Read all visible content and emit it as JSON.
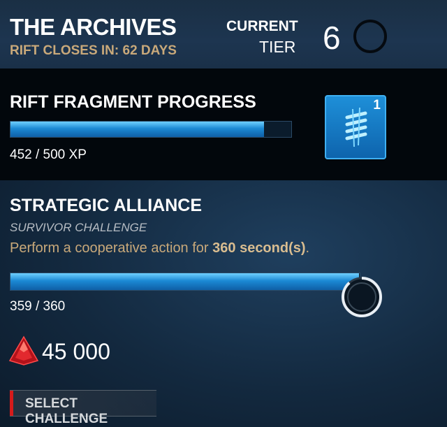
{
  "header": {
    "title": "THE ARCHIVES",
    "rift_closes": "RIFT CLOSES IN: 62 DAYS",
    "current_label": "CURRENT",
    "tier_label": "TIER",
    "tier_value": "6"
  },
  "rift_fragment": {
    "title": "RIFT FRAGMENT PROGRESS",
    "progress_text": "452 / 500 XP",
    "progress_fraction": 0.904,
    "reward_count": "1",
    "reward_icon": "rift-fragment-icon"
  },
  "challenge": {
    "title": "STRATEGIC ALLIANCE",
    "type": "SURVIVOR CHALLENGE",
    "description_prefix": "Perform a cooperative action for ",
    "description_value": "360 second(s)",
    "description_suffix": ".",
    "progress_text": "359 / 360",
    "progress_fraction": 0.997,
    "cost": "45 000",
    "cost_icon": "auric-cell-gem-icon",
    "select_button": "SELECT CHALLENGE"
  },
  "colors": {
    "accent_gold": "#c9a97a",
    "progress_blue": "#1c89d4",
    "button_accent": "#d61b1b"
  }
}
